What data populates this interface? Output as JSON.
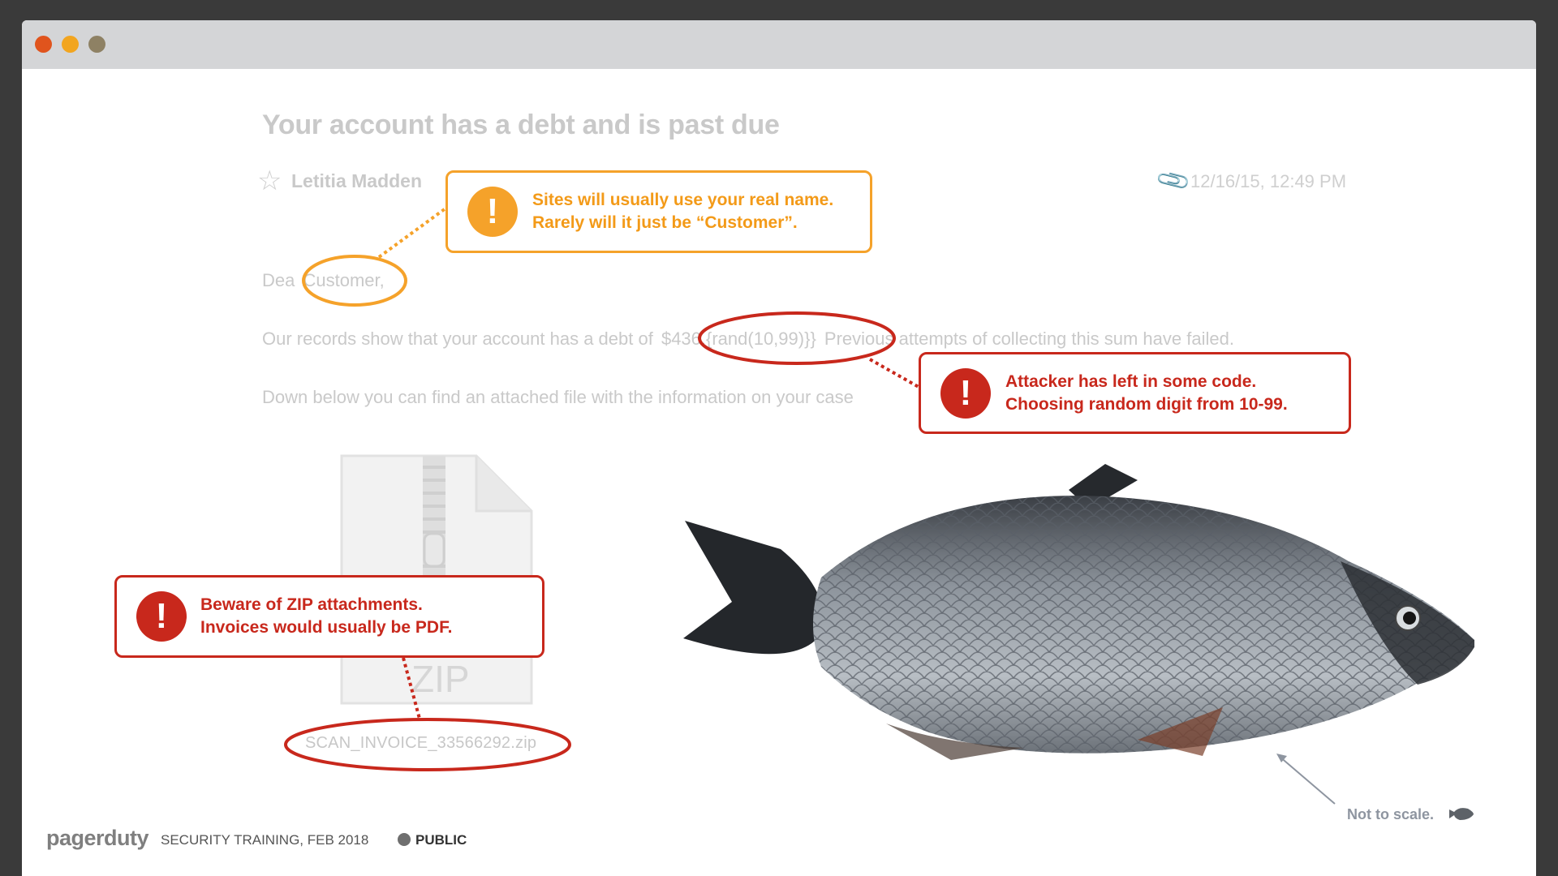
{
  "email": {
    "subject": "Your account has a debt and is past due",
    "sender": "Letitia Madden",
    "date": "12/16/15, 12:49 PM",
    "line1": {
      "prefix": "Dea",
      "highlight": "Customer,"
    },
    "line2": {
      "prefix": "Our records show that your account has a debt of",
      "highlight": "$436.{rand(10,99)}}",
      "suffix": "Previous attempts of collecting this sum have failed."
    },
    "line3": "Down below you can find an attached file with the information on your case",
    "attachment": {
      "type_label": "ZIP",
      "filename": "SCAN_INVOICE_33566292.zip"
    }
  },
  "callouts": {
    "name": {
      "line1": "Sites will usually use your real name.",
      "line2": "Rarely will it just be “Customer”.",
      "color": "#f5a22a",
      "icon": "exclamation-icon"
    },
    "code": {
      "line1": "Attacker has left in some code.",
      "line2": "Choosing random digit from 10-99.",
      "color": "#c8281c",
      "icon": "exclamation-icon"
    },
    "zip": {
      "line1": "Beware of ZIP attachments.",
      "line2": "Invoices would usually be PDF.",
      "color": "#c8281c",
      "icon": "exclamation-icon"
    }
  },
  "fish": {
    "note": "Not to scale."
  },
  "footer": {
    "brand": "pagerduty",
    "caption": "SECURITY TRAINING, FEB 2018",
    "classification": "PUBLIC"
  }
}
